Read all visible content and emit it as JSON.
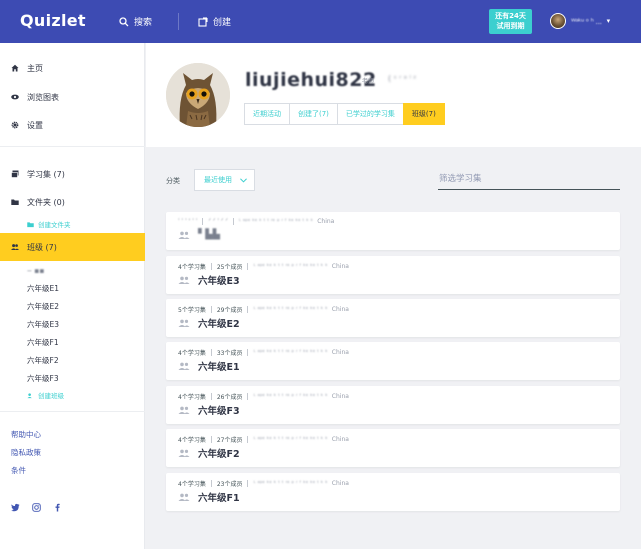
{
  "topbar": {
    "logo": "Quizlet",
    "search_label": "搜索",
    "create_label": "创建",
    "trial_line1": "还有24天",
    "trial_line2": "试用到期",
    "user_name": "ᵂᵃᵏᵘ ᵒ ʰ ..."
  },
  "sidebar": {
    "home": "主页",
    "progress": "浏览图表",
    "settings": "设置",
    "study_sets": "学习集 (7)",
    "folders": "文件夹 (0)",
    "create_folder": "创建文件夹",
    "classes": "班级 (7)",
    "class_list": [
      "‒ ▪▪",
      "六年级E1",
      "六年级E2",
      "六年级E3",
      "六年级F1",
      "六年级F2",
      "六年级F3"
    ],
    "create_class": "创建班级",
    "help": "帮助中心",
    "privacy": "隐私政策",
    "terms": "条件"
  },
  "profile": {
    "username": "liujiehui822",
    "role_tag": "老师",
    "user_id": "( ˢ ʳ ᵃ ˡ ᶻ",
    "tabs": [
      "近期活动",
      "创建了(7)",
      "已学过的学习集",
      "班级(7)"
    ],
    "active_tab": "班级(7)"
  },
  "filters": {
    "sort_label": "分类",
    "sort_value": "最近使用",
    "filter_placeholder": "筛选学习集"
  },
  "classes": [
    {
      "sets": "ˈ ˈ ˈ ' ˈ ˈ",
      "members": "ᐟ ᐟ ˈ ᐟ ᐟ",
      "school": "ᴸ ᵃᵖᵉ ᵏᵉ ᵏ ᵗ ᵗ ʳᵉ ᵖ ʳ ᶠ ᵏᵉ ᵏᵉ ᵗ ᵏ ᵏ",
      "country": "China",
      "name": "▘▙▙"
    },
    {
      "sets": "4个学习集",
      "members": "25个成员",
      "school": "ᴸ ᵃᵖᵉ ᵏᵉ ᵏ ᵗ ᵗ ʳᵉ ᵖ ʳ ᶠ ᵏᵉ ᵏᵉ ᵗ ᵏ ᵏ",
      "country": "China",
      "name": "六年级E3"
    },
    {
      "sets": "5个学习集",
      "members": "29个成员",
      "school": "ᴸ ᵃᵖᵉ ᵏᵉ ᵏ ᵗ ᵗ ʳᵉ ᵖ ʳ ᶠ ᵏᵉ ᵏᵉ ᵗ ᵏ ᵏ",
      "country": "China",
      "name": "六年级E2"
    },
    {
      "sets": "4个学习集",
      "members": "33个成员",
      "school": "ᴸ ᵃᵖᵉ ᵏᵉ ᵏ ᵗ ᵗ ʳᵉ ᵖ ʳ ᶠ ᵏᵉ ᵏᵉ ᵗ ᵏ ᵏ",
      "country": "China",
      "name": "六年级E1"
    },
    {
      "sets": "4个学习集",
      "members": "26个成员",
      "school": "ᴸ ᵃᵖᵉ ᵏᵉ ᵏ ᵗ ᵗ ʳᵉ ᵖ ʳ ᶠ ᵏᵉ ᵏᵉ ᵗ ᵏ ᵏ",
      "country": "China",
      "name": "六年级F3"
    },
    {
      "sets": "4个学习集",
      "members": "27个成员",
      "school": "ᴸ ᵃᵖᵉ ᵏᵉ ᵏ ᵗ ᵗ ʳᵉ ᵖ ʳ ᶠ ᵏᵉ ᵏᵉ ᵗ ᵏ ᵏ",
      "country": "China",
      "name": "六年级F2"
    },
    {
      "sets": "4个学习集",
      "members": "23个成员",
      "school": "ᴸ ᵃᵖᵉ ᵏᵉ ᵏ ᵗ ᵗ ʳᵉ ᵖ ʳ ᶠ ᵏᵉ ᵏᵉ ᵗ ᵏ ᵏ",
      "country": "China",
      "name": "六年级F1"
    }
  ],
  "colors": {
    "brand": "#3d4bb3",
    "accent_yellow": "#ffcd1f",
    "accent_teal": "#3ccfcf"
  }
}
